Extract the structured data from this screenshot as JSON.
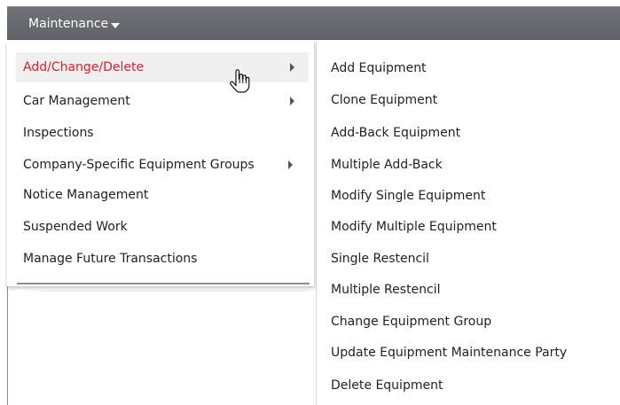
{
  "header": {
    "menu_label": "Maintenance",
    "caret_icon": "caret-down-icon"
  },
  "main_menu": {
    "items": [
      {
        "label": "Add/Change/Delete",
        "has_submenu": true,
        "active": true
      },
      {
        "label": "Car Management",
        "has_submenu": true,
        "active": false
      },
      {
        "label": "Inspections",
        "has_submenu": false,
        "active": false
      },
      {
        "label": "Company-Specific Equipment Groups",
        "has_submenu": true,
        "active": false
      },
      {
        "label": "Notice Management",
        "has_submenu": false,
        "active": false
      },
      {
        "label": "Suspended Work",
        "has_submenu": false,
        "active": false
      },
      {
        "label": "Manage Future Transactions",
        "has_submenu": false,
        "active": false
      }
    ]
  },
  "submenu": {
    "items": [
      {
        "label": "Add Equipment"
      },
      {
        "label": "Clone Equipment"
      },
      {
        "label": "Add-Back Equipment"
      },
      {
        "label": "Multiple Add-Back"
      },
      {
        "label": "Modify Single Equipment"
      },
      {
        "label": "Modify Multiple Equipment"
      },
      {
        "label": "Single Restencil"
      },
      {
        "label": "Multiple Restencil"
      },
      {
        "label": "Change Equipment Group"
      },
      {
        "label": "Update Equipment Maintenance Party"
      },
      {
        "label": "Delete Equipment"
      }
    ]
  },
  "colors": {
    "topbar": "#666a6f",
    "active_text": "#e21b2d",
    "text": "#222222"
  },
  "icons": {
    "submenu_arrow": "right-triangle-icon",
    "cursor": "hand-pointer-icon"
  }
}
